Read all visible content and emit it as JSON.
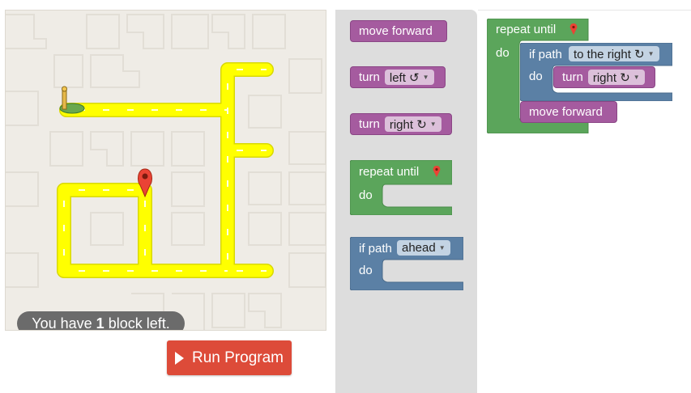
{
  "maze": {
    "status_prefix": "You have ",
    "status_count": "1",
    "status_suffix": " block left.",
    "colors": {
      "background": "#efece6",
      "path": "#ffff00",
      "path_edge": "#d8d800",
      "marker": "#ea4335"
    }
  },
  "run_button": {
    "label": "Run Program"
  },
  "toolbox": {
    "move_forward": "move forward",
    "turn_left": {
      "label": "turn",
      "dropdown": "left ↺"
    },
    "turn_right": {
      "label": "turn",
      "dropdown": "right ↻"
    },
    "repeat_until": {
      "label": "repeat until",
      "do": "do"
    },
    "if_path": {
      "label": "if path",
      "dropdown": "ahead",
      "do": "do"
    }
  },
  "workspace": {
    "repeat_label": "repeat until",
    "do_label": "do",
    "if_label": "if path",
    "if_dropdown": "to the right ↻",
    "inner_do": "do",
    "turn_label": "turn",
    "turn_dropdown": "right ↻",
    "move_label": "move forward"
  }
}
